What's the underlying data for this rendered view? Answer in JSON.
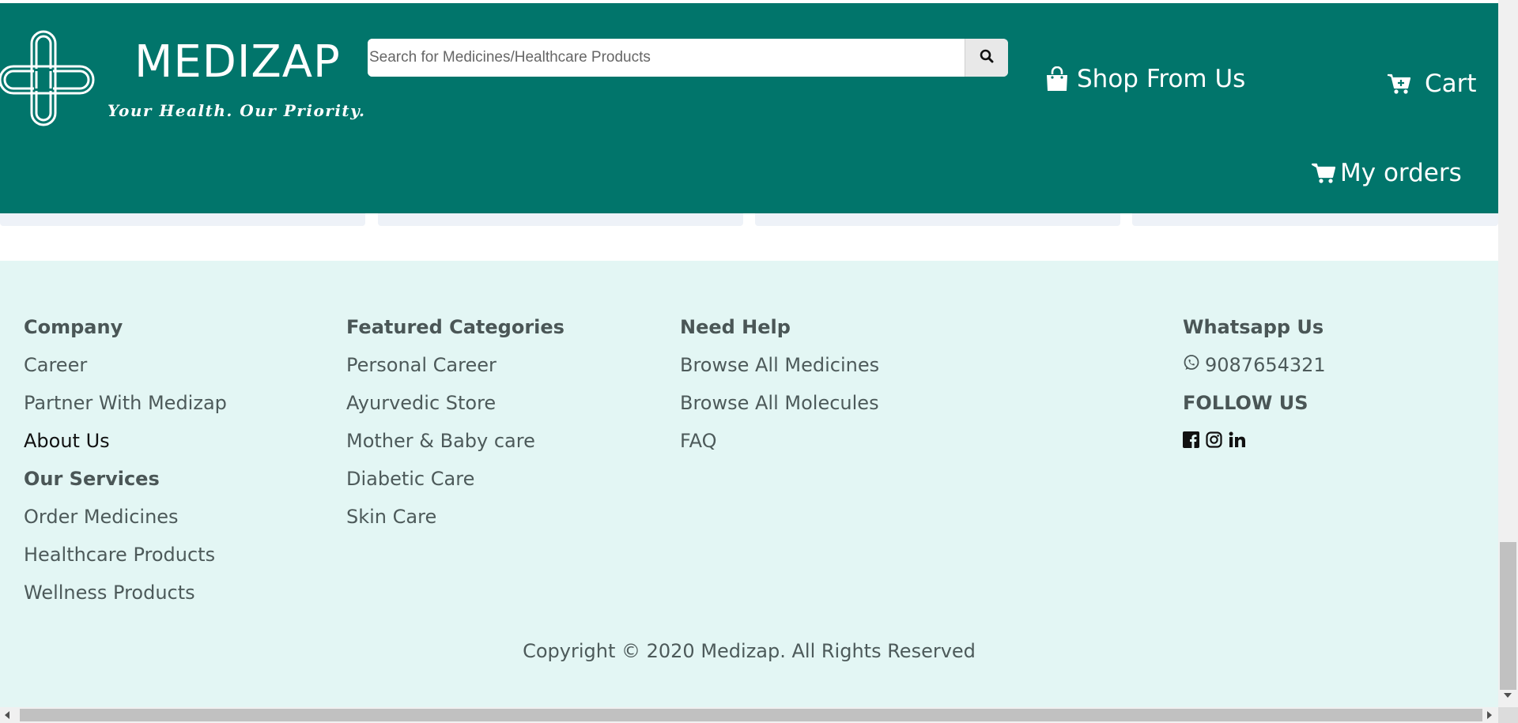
{
  "header": {
    "brand_name": "MEDIZAP",
    "tagline": "Your Health. Our Priority.",
    "logo_icon": "medical-cross-logo",
    "search": {
      "placeholder": "Search for Medicines/Healthcare Products",
      "value": "",
      "button_icon": "search-icon"
    },
    "nav": {
      "shop_label": "Shop From Us",
      "shop_icon": "shopping-bag-icon",
      "cart_label": "Cart",
      "cart_icon": "cart-plus-icon",
      "orders_label": "My orders",
      "orders_icon": "shopping-cart-icon"
    },
    "bg_color": "#01756b"
  },
  "footer": {
    "bg_color": "#e3f6f4",
    "company": {
      "heading": "Company",
      "links": [
        "Career",
        "Partner With Medizap",
        "About Us"
      ]
    },
    "services": {
      "heading": "Our Services",
      "links": [
        "Order Medicines",
        "Healthcare Products",
        "Wellness Products"
      ]
    },
    "featured": {
      "heading": "Featured Categories",
      "links": [
        "Personal Career",
        "Ayurvedic Store",
        "Mother & Baby care",
        "Diabetic Care",
        "Skin Care"
      ]
    },
    "help": {
      "heading": "Need Help",
      "links": [
        "Browse All Medicines",
        "Browse All Molecules",
        "FAQ"
      ]
    },
    "whatsapp": {
      "heading": "Whatsapp Us",
      "phone": "9087654321",
      "phone_icon": "whatsapp-icon"
    },
    "follow": {
      "heading": "FOLLOW US",
      "icons": [
        "facebook-icon",
        "instagram-icon",
        "linkedin-icon"
      ]
    },
    "copyright": "Copyright © 2020 Medizap. All Rights Reserved"
  }
}
